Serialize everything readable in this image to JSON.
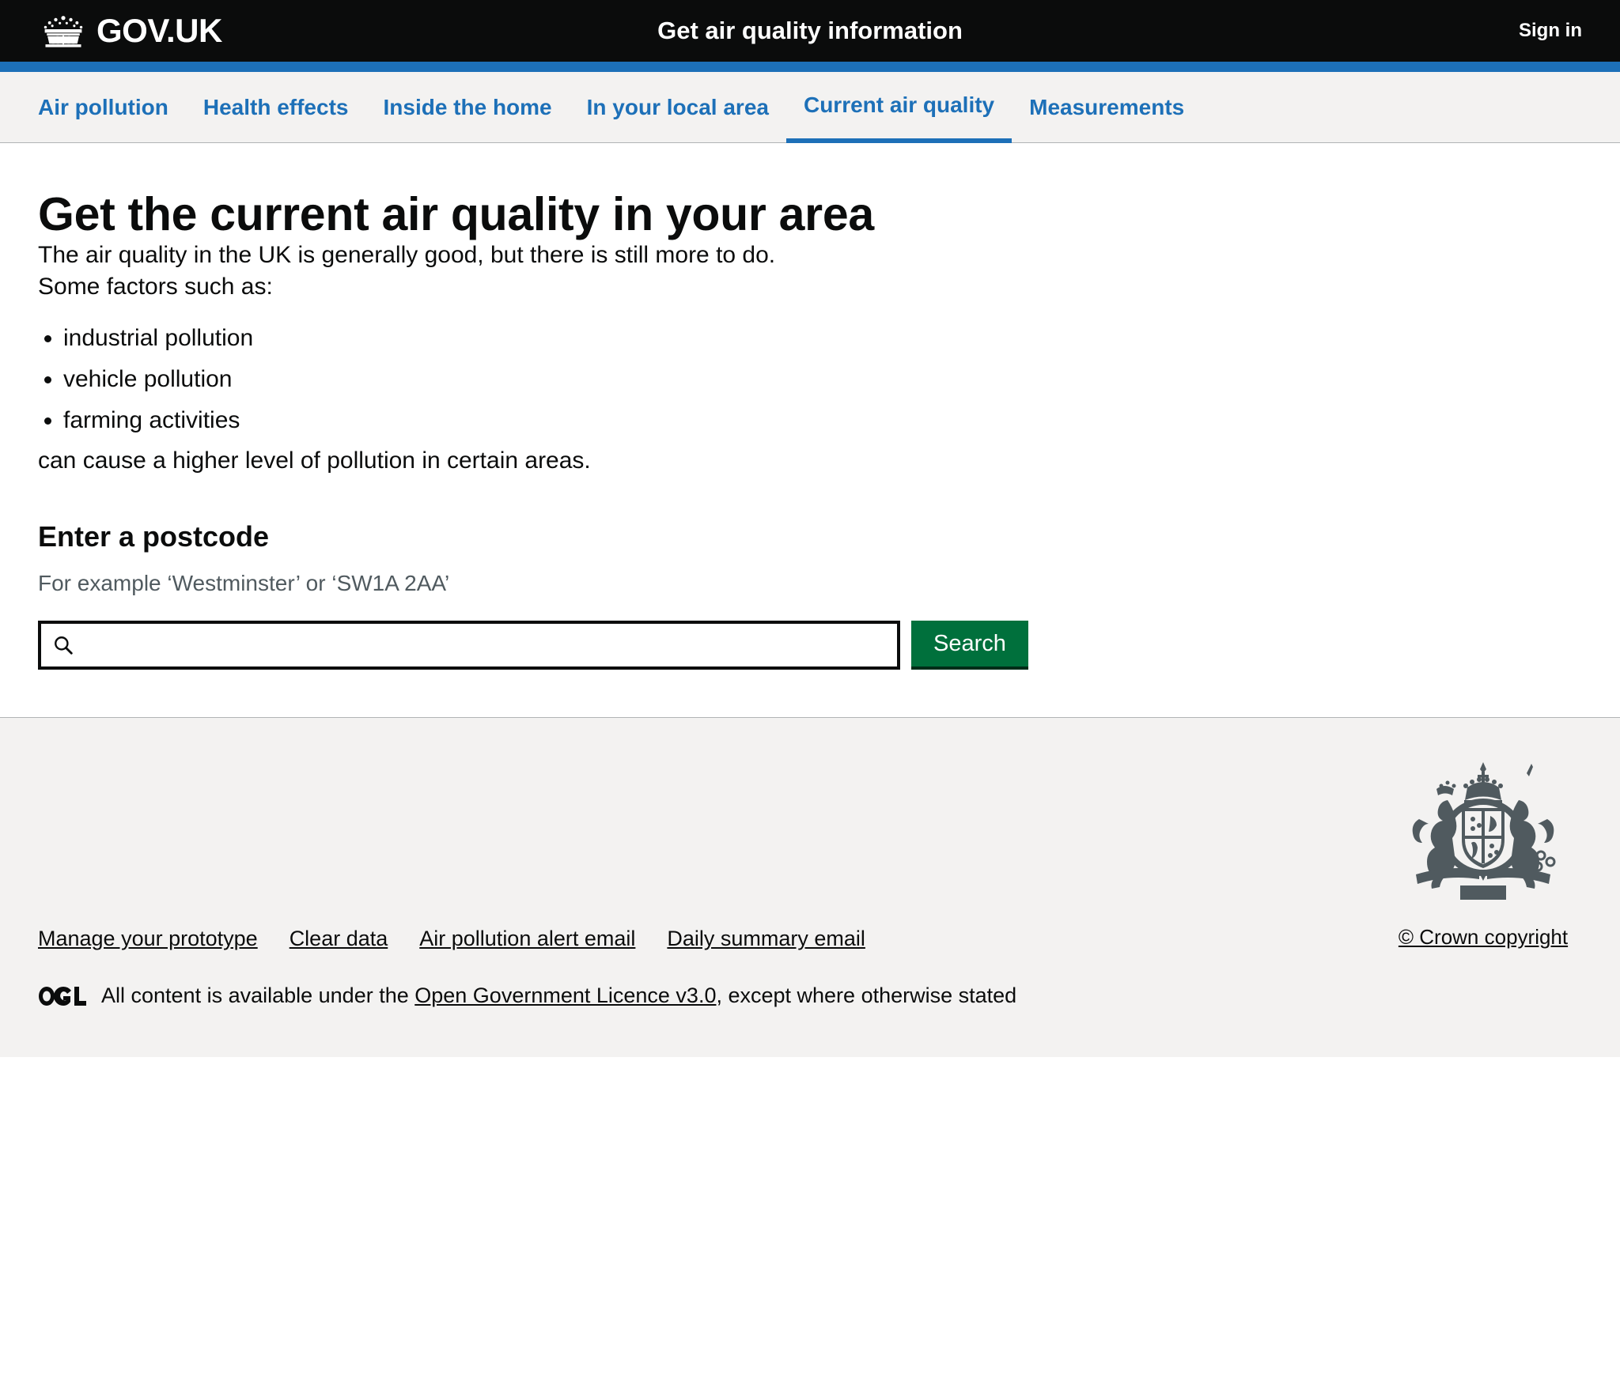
{
  "header": {
    "logo_text": "GOV.UK",
    "crown_icon": "crown-icon",
    "service_name": "Get air quality information",
    "sign_in_label": "Sign in",
    "bar_color": "#1d70b8",
    "background_color": "#0b0c0c"
  },
  "nav": {
    "items": [
      {
        "label": "Air pollution",
        "current": false
      },
      {
        "label": "Health effects",
        "current": false
      },
      {
        "label": "Inside the home",
        "current": false
      },
      {
        "label": "In your local area",
        "current": false
      },
      {
        "label": "Current air quality",
        "current": true
      },
      {
        "label": "Measurements",
        "current": false
      }
    ],
    "link_color": "#1d70b8",
    "background_color": "#f3f2f1"
  },
  "main": {
    "heading": "Get the current air quality in your area",
    "intro_paragraph": "The air quality in the UK is generally good, but there is still more to do.",
    "factors_lead": "Some factors such as:",
    "factors": [
      "industrial pollution",
      "vehicle pollution",
      "farming activities"
    ],
    "factors_trailer": "can cause a higher level of pollution in certain areas.",
    "postcode_heading": "Enter a postcode",
    "postcode_hint": "For example ‘Westminster’ or ‘SW1A 2AA’"
  },
  "search": {
    "icon": "search-icon",
    "value": "",
    "placeholder": "",
    "button_label": "Search",
    "button_color": "#00703c"
  },
  "footer": {
    "links": [
      "Manage your prototype",
      "Clear data",
      "Air pollution alert email",
      "Daily summary email"
    ],
    "ogl_logo_text": "OGL",
    "licence_prefix": "All content is available under the ",
    "licence_link": "Open Government Licence v3.0",
    "licence_suffix": ", except where otherwise stated",
    "crest_icon": "royal-coat-of-arms-icon",
    "crown_copyright": "© Crown copyright",
    "background_color": "#f3f2f1"
  }
}
